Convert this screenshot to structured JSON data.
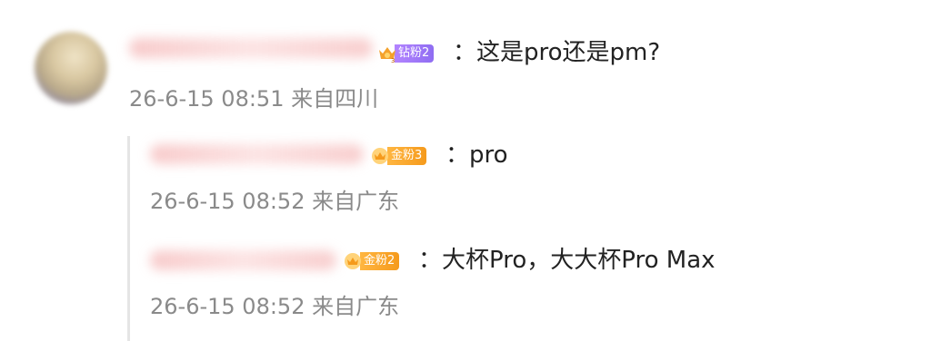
{
  "colors": {
    "purple_badge": "#9b74f7",
    "gold_badge": "#f6a525",
    "meta_text": "#8a8a8a",
    "main_text": "#222222"
  },
  "main_comment": {
    "badge_label": "钻粉2",
    "badge_icon": "crown-icon",
    "text": "：这是pro还是pm?",
    "meta": "26-6-15 08:51 来自四川"
  },
  "replies": [
    {
      "badge_label": "金粉3",
      "badge_icon": "crown-icon",
      "text": "：pro",
      "meta": "26-6-15 08:52 来自广东"
    },
    {
      "badge_label": "金粉2",
      "badge_icon": "crown-icon",
      "text": "：大杯Pro，大大杯Pro Max",
      "meta": "26-6-15 08:52 来自广东"
    }
  ]
}
